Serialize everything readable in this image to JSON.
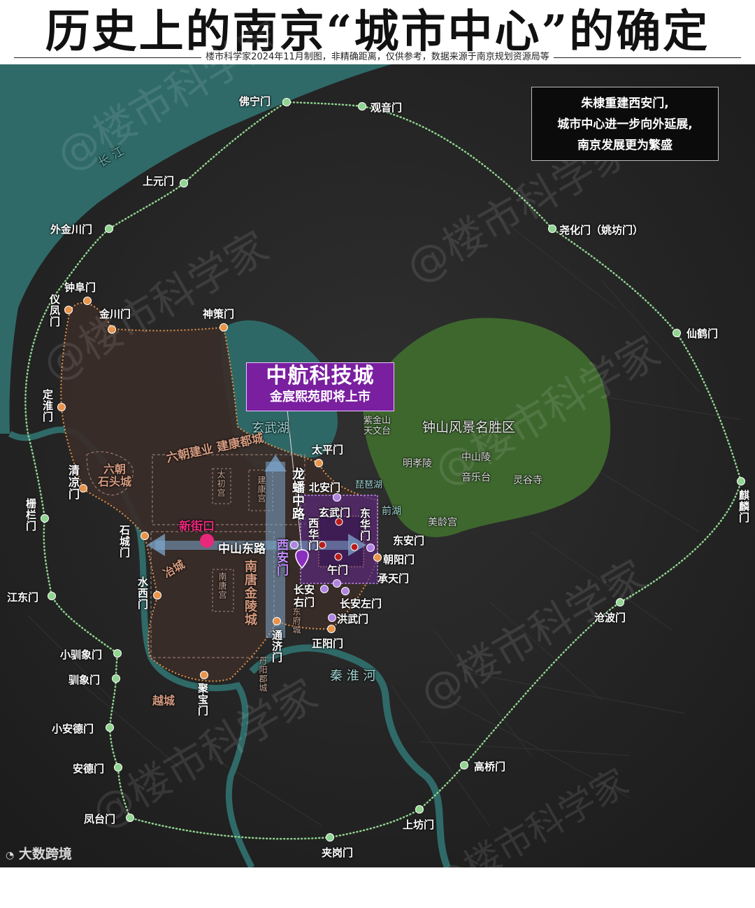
{
  "header": {
    "title": "历史上的南京“城市中心”的确定",
    "subtitle": "楼市科学家2024年11月制图，非精确距离，仅供参考，数据来源于南京规划资源局等"
  },
  "callout": {
    "lines": [
      "朱棣重建西安门,",
      "城市中心进一步向外延展,",
      "南京发展更为繁盛"
    ]
  },
  "promo": {
    "title": "中航科技城",
    "subtitle": "金宸熙苑即将上市"
  },
  "watermark": "@楼市科学家",
  "logo": "大数跨境",
  "colors": {
    "outer_wall": "#8fd48f",
    "city_wall": "#e8944a",
    "palace": "#b084e0",
    "palace_red": "#b81d1d",
    "xinjiekou": "#e8287a",
    "purple_box": "#7a1fa0",
    "river": "#2f6a68",
    "scenic": "#3f6a2e"
  },
  "labels": {
    "changjiang": "长 江",
    "xuanwuhu": "玄武湖",
    "qinhuaihe": "秦 淮 河",
    "scenic_area": "钟山风景名胜区",
    "zijinshan": "紫金山\n天文台",
    "mingxiaoling": "明孝陵",
    "zhongshanling": "中山陵",
    "yinyuetai": "音乐台",
    "linggusi": "灵谷寺",
    "meilinggong": "美龄宫",
    "pipahu": "琵琶湖",
    "qianhu": "前湖",
    "liuchao_jiankang": "六朝建业  建康都城",
    "taichugong": "太初宫",
    "jiankanggong": "建康宫",
    "liuchao_shitou": "六朝\n石头城",
    "xinjiekou": "新街口",
    "zhongshandonglu": "中山东路",
    "longpan_road": "龙蟠中路",
    "yecheng": "冶城",
    "nantanggong": "南唐宫",
    "nantang_jinling": "南唐金陵城",
    "dongfucheng": "东府城",
    "danyangjuncheng": "丹阳郡城",
    "yuecheng": "越城"
  },
  "outer_gates": [
    {
      "name": "佛宁门",
      "p": [
        410,
        146
      ]
    },
    {
      "name": "观音门",
      "p": [
        518,
        152
      ]
    },
    {
      "name": "上元门",
      "p": [
        263,
        262
      ]
    },
    {
      "name": "外金川门",
      "p": [
        156,
        327
      ]
    },
    {
      "name": "尧化门（姚坊门）",
      "p": [
        790,
        327
      ]
    },
    {
      "name": "仙鹤门",
      "p": [
        968,
        476
      ]
    },
    {
      "name": "麒麟门",
      "p": [
        1060,
        688
      ]
    },
    {
      "name": "栅栏门",
      "p": [
        64,
        741
      ]
    },
    {
      "name": "江东门",
      "p": [
        74,
        852
      ]
    },
    {
      "name": "沧波门",
      "p": [
        887,
        861
      ]
    },
    {
      "name": "小驯象门",
      "p": [
        168,
        934
      ]
    },
    {
      "name": "驯象门",
      "p": [
        166,
        970
      ]
    },
    {
      "name": "小安德门",
      "p": [
        157,
        1040
      ]
    },
    {
      "name": "安德门",
      "p": [
        169,
        1097
      ]
    },
    {
      "name": "高桥门",
      "p": [
        664,
        1094
      ]
    },
    {
      "name": "凤台门",
      "p": [
        186,
        1169
      ]
    },
    {
      "name": "上坊门",
      "p": [
        600,
        1157
      ]
    },
    {
      "name": "夹岗门",
      "p": [
        472,
        1197
      ]
    }
  ],
  "city_gates": [
    {
      "name": "钟阜门",
      "p": [
        125,
        430
      ]
    },
    {
      "name": "仪凤门",
      "p": [
        98,
        443
      ]
    },
    {
      "name": "金川门",
      "p": [
        160,
        471
      ]
    },
    {
      "name": "神策门",
      "p": [
        320,
        468
      ]
    },
    {
      "name": "定淮门",
      "p": [
        88,
        582
      ]
    },
    {
      "name": "太平门",
      "p": [
        456,
        662
      ]
    },
    {
      "name": "清凉门",
      "p": [
        119,
        698
      ]
    },
    {
      "name": "石城门",
      "p": [
        207,
        766
      ]
    },
    {
      "name": "朝阳门",
      "p": [
        540,
        797
      ]
    },
    {
      "name": "水西门",
      "p": [
        225,
        851
      ]
    },
    {
      "name": "通济门",
      "p": [
        396,
        888
      ]
    },
    {
      "name": "正阳门",
      "p": [
        474,
        899
      ]
    },
    {
      "name": "聚宝门",
      "p": [
        292,
        965
      ]
    }
  ],
  "palace_gates": [
    {
      "name": "北安门",
      "p": [
        482,
        711
      ]
    },
    {
      "name": "西安门",
      "p": [
        421,
        779
      ]
    },
    {
      "name": "东安门",
      "p": [
        530,
        783
      ]
    },
    {
      "name": "承天门",
      "p": [
        482,
        834
      ]
    },
    {
      "name": "长安右门",
      "p": [
        464,
        842
      ]
    },
    {
      "name": "长安左门",
      "p": [
        494,
        845
      ]
    },
    {
      "name": "洪武门",
      "p": [
        475,
        883
      ]
    }
  ],
  "inner_palace_gates": [
    {
      "name": "玄武门",
      "p": [
        485,
        746
      ]
    },
    {
      "name": "西华门",
      "p": [
        461,
        779
      ]
    },
    {
      "name": "东华门",
      "p": [
        507,
        782
      ]
    },
    {
      "name": "午门",
      "p": [
        484,
        796
      ]
    }
  ]
}
